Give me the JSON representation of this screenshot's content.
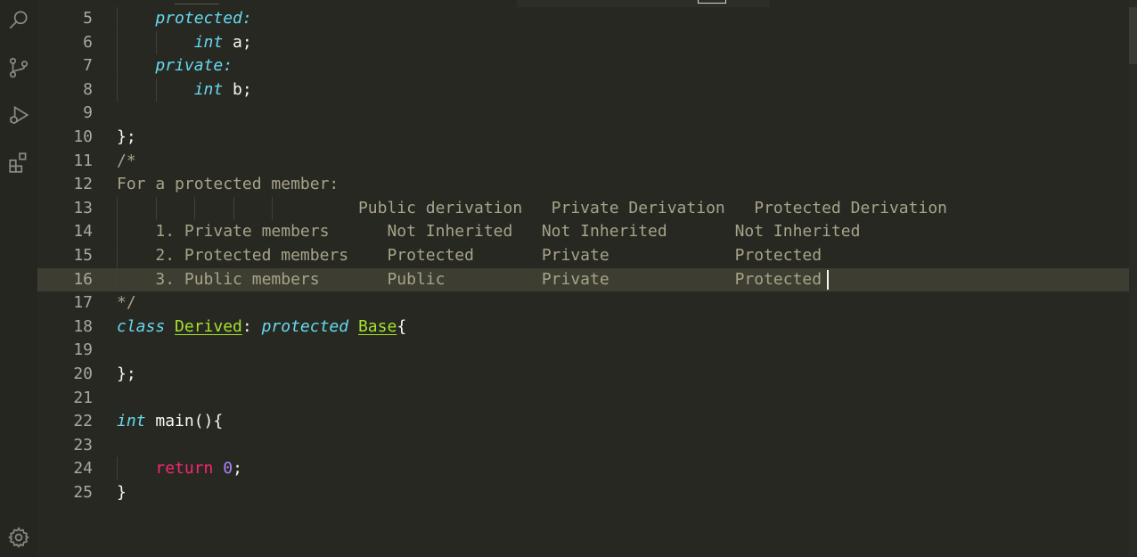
{
  "activity_bar": {
    "icons": [
      "search-icon",
      "source-control-icon",
      "run-debug-icon",
      "extensions-icon",
      "settings-gear-icon"
    ]
  },
  "colors": {
    "background": "#272822",
    "keyword": "#66d9ef",
    "return_keyword": "#f92672",
    "number": "#ae81ff",
    "class_name": "#a6e22e",
    "comment": "#a7a389",
    "text": "#f8f8f2",
    "current_line": "#3e3d32"
  },
  "editor": {
    "current_line": "16",
    "lines": [
      {
        "num": "5",
        "indent": "    ",
        "tokens": [
          {
            "t": "protected:",
            "c": "kw"
          }
        ]
      },
      {
        "num": "6",
        "indent": "        ",
        "tokens": [
          {
            "t": "int",
            "c": "kw"
          },
          {
            "t": " a;",
            "c": ""
          }
        ]
      },
      {
        "num": "7",
        "indent": "    ",
        "tokens": [
          {
            "t": "private:",
            "c": "kw"
          }
        ]
      },
      {
        "num": "8",
        "indent": "        ",
        "tokens": [
          {
            "t": "int",
            "c": "kw"
          },
          {
            "t": " b;",
            "c": ""
          }
        ]
      },
      {
        "num": "9",
        "indent": "",
        "tokens": []
      },
      {
        "num": "10",
        "indent": "",
        "tokens": [
          {
            "t": "};",
            "c": ""
          }
        ]
      },
      {
        "num": "11",
        "indent": "",
        "tokens": [
          {
            "t": "/*",
            "c": "cm"
          }
        ]
      },
      {
        "num": "12",
        "indent": "",
        "tokens": [
          {
            "t": "For a protected member:",
            "c": "cm"
          }
        ]
      },
      {
        "num": "13",
        "indent": "                         ",
        "tokens": [
          {
            "t": "Public derivation   Private Derivation   Protected Derivation",
            "c": "cm"
          }
        ]
      },
      {
        "num": "14",
        "indent": "    ",
        "tokens": [
          {
            "t": "1. Private members      Not Inherited   Not Inherited       Not Inherited",
            "c": "cm"
          }
        ]
      },
      {
        "num": "15",
        "indent": "    ",
        "tokens": [
          {
            "t": "2. Protected members    Protected       Private             Protected",
            "c": "cm"
          }
        ]
      },
      {
        "num": "16",
        "indent": "    ",
        "tokens": [
          {
            "t": "3. Public members       Public          Private             Protected",
            "c": "cm"
          }
        ]
      },
      {
        "num": "17",
        "indent": "",
        "tokens": [
          {
            "t": "*/",
            "c": "cm"
          }
        ]
      },
      {
        "num": "18",
        "indent": "",
        "tokens": [
          {
            "t": "class",
            "c": "kw"
          },
          {
            "t": " ",
            "c": ""
          },
          {
            "t": "Derived",
            "c": "cls"
          },
          {
            "t": ": ",
            "c": ""
          },
          {
            "t": "protected",
            "c": "kw"
          },
          {
            "t": " ",
            "c": ""
          },
          {
            "t": "Base",
            "c": "cls"
          },
          {
            "t": "{",
            "c": ""
          }
        ]
      },
      {
        "num": "19",
        "indent": "",
        "tokens": []
      },
      {
        "num": "20",
        "indent": "",
        "tokens": [
          {
            "t": "};",
            "c": ""
          }
        ]
      },
      {
        "num": "21",
        "indent": "",
        "tokens": []
      },
      {
        "num": "22",
        "indent": "",
        "tokens": [
          {
            "t": "int",
            "c": "kw"
          },
          {
            "t": " main(){",
            "c": ""
          }
        ]
      },
      {
        "num": "23",
        "indent": "",
        "tokens": []
      },
      {
        "num": "24",
        "indent": "    ",
        "tokens": [
          {
            "t": "return",
            "c": "ret"
          },
          {
            "t": " ",
            "c": ""
          },
          {
            "t": "0",
            "c": "num"
          },
          {
            "t": ";",
            "c": ""
          }
        ]
      },
      {
        "num": "25",
        "indent": "",
        "tokens": [
          {
            "t": "}",
            "c": ""
          }
        ]
      }
    ]
  }
}
